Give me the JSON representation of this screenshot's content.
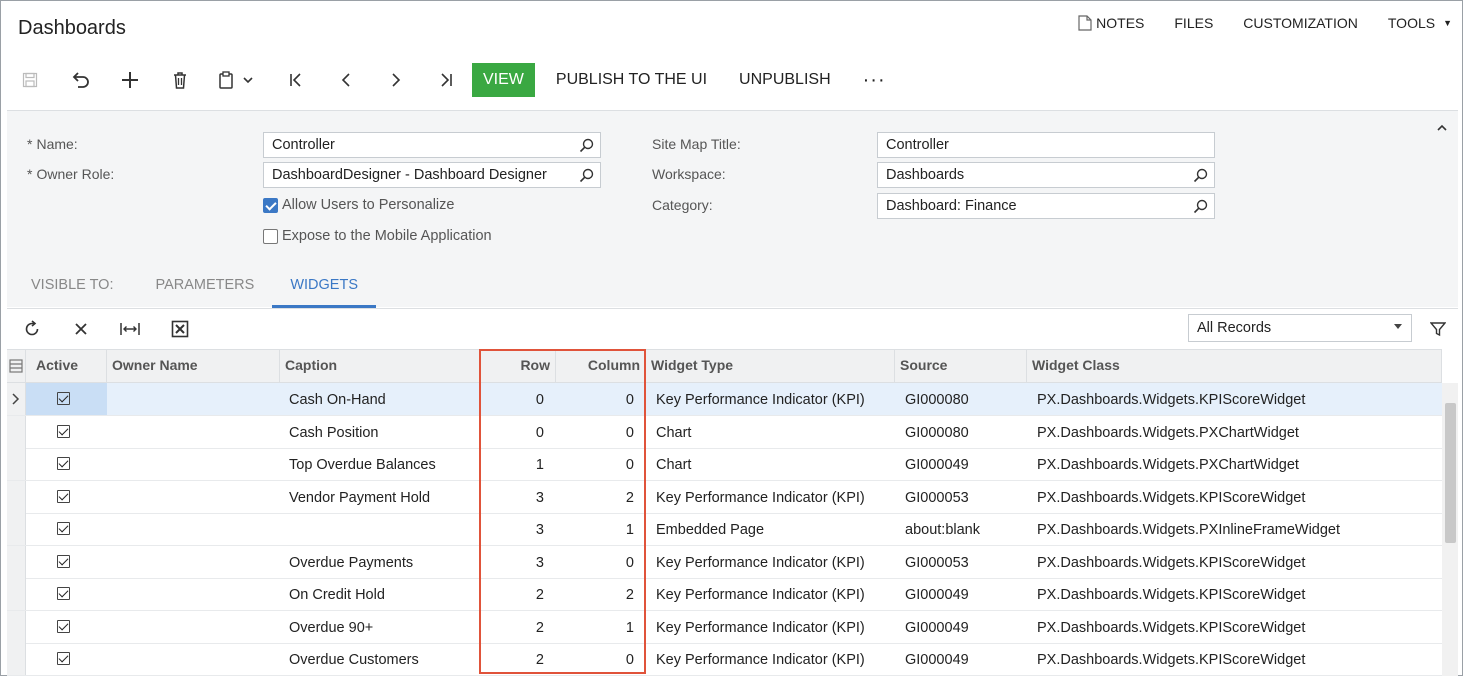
{
  "header": {
    "title": "Dashboards",
    "links": [
      {
        "label": "NOTES"
      },
      {
        "label": "FILES"
      },
      {
        "label": "CUSTOMIZATION"
      },
      {
        "label": "TOOLS"
      }
    ]
  },
  "toolbar": {
    "view_label": "VIEW",
    "publish_label": "PUBLISH TO THE UI",
    "unpublish_label": "UNPUBLISH",
    "more_label": "···",
    "accent": "#3aa842"
  },
  "form": {
    "name_label": "Name:",
    "name_value": "Controller",
    "owner_role_label": "Owner Role:",
    "owner_role_value": "DashboardDesigner - Dashboard Designer",
    "allow_personalize_label": "Allow Users to Personalize",
    "allow_personalize_checked": true,
    "expose_mobile_label": "Expose to the Mobile Application",
    "expose_mobile_checked": false,
    "site_map_title_label": "Site Map Title:",
    "site_map_title_value": "Controller",
    "workspace_label": "Workspace:",
    "workspace_value": "Dashboards",
    "category_label": "Category:",
    "category_value": "Dashboard: Finance"
  },
  "tabs": [
    {
      "label": "VISIBLE TO:",
      "active": false
    },
    {
      "label": "PARAMETERS",
      "active": false
    },
    {
      "label": "WIDGETS",
      "active": true
    }
  ],
  "grid": {
    "filter_value": "All Records",
    "columns": {
      "active": "Active",
      "owner": "Owner Name",
      "caption": "Caption",
      "row": "Row",
      "column": "Column",
      "type": "Widget Type",
      "source": "Source",
      "class": "Widget Class"
    },
    "rows": [
      {
        "active": true,
        "owner": "",
        "caption": "Cash On-Hand",
        "row": "0",
        "column": "0",
        "type": "Key Performance Indicator (KPI)",
        "source": "GI000080",
        "class": "PX.Dashboards.Widgets.KPIScoreWidget"
      },
      {
        "active": true,
        "owner": "",
        "caption": "Cash Position",
        "row": "0",
        "column": "0",
        "type": "Chart",
        "source": "GI000080",
        "class": "PX.Dashboards.Widgets.PXChartWidget"
      },
      {
        "active": true,
        "owner": "",
        "caption": "Top Overdue Balances",
        "row": "1",
        "column": "0",
        "type": "Chart",
        "source": "GI000049",
        "class": "PX.Dashboards.Widgets.PXChartWidget"
      },
      {
        "active": true,
        "owner": "",
        "caption": "Vendor Payment Hold",
        "row": "3",
        "column": "2",
        "type": "Key Performance Indicator (KPI)",
        "source": "GI000053",
        "class": "PX.Dashboards.Widgets.KPIScoreWidget"
      },
      {
        "active": true,
        "owner": "",
        "caption": "",
        "row": "3",
        "column": "1",
        "type": "Embedded Page",
        "source": "about:blank",
        "class": "PX.Dashboards.Widgets.PXInlineFrameWidget"
      },
      {
        "active": true,
        "owner": "",
        "caption": "Overdue Payments",
        "row": "3",
        "column": "0",
        "type": "Key Performance Indicator (KPI)",
        "source": "GI000053",
        "class": "PX.Dashboards.Widgets.KPIScoreWidget"
      },
      {
        "active": true,
        "owner": "",
        "caption": "On Credit Hold",
        "row": "2",
        "column": "2",
        "type": "Key Performance Indicator (KPI)",
        "source": "GI000049",
        "class": "PX.Dashboards.Widgets.KPIScoreWidget"
      },
      {
        "active": true,
        "owner": "",
        "caption": "Overdue 90+",
        "row": "2",
        "column": "1",
        "type": "Key Performance Indicator (KPI)",
        "source": "GI000049",
        "class": "PX.Dashboards.Widgets.KPIScoreWidget"
      },
      {
        "active": true,
        "owner": "",
        "caption": "Overdue Customers",
        "row": "2",
        "column": "0",
        "type": "Key Performance Indicator (KPI)",
        "source": "GI000049",
        "class": "PX.Dashboards.Widgets.KPIScoreWidget"
      }
    ]
  }
}
